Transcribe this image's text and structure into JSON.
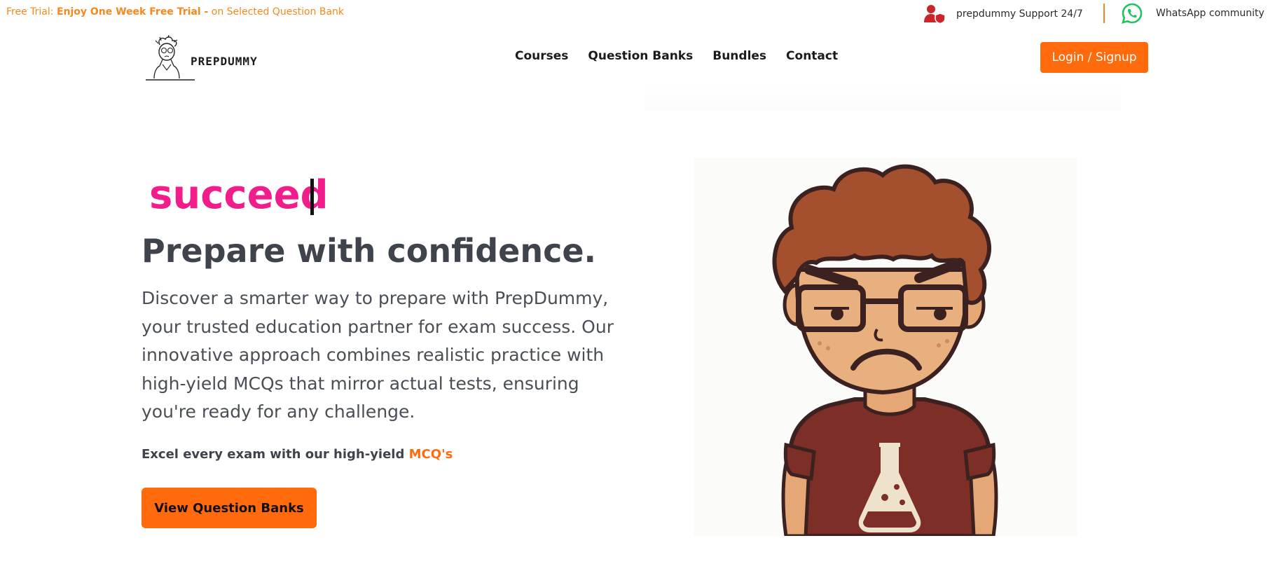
{
  "topbar": {
    "promo_prefix": "Free Trial: ",
    "promo_bold": "Enjoy One Week Free Trial -",
    "promo_suffix": " on Selected Question Bank",
    "support_icon": "user-shield-icon",
    "support_label": "prepdummy Support 24/7",
    "whatsapp_icon": "whatsapp-icon",
    "whatsapp_label": "WhatsApp community"
  },
  "navbar": {
    "logo_text": "PREPDUMMY",
    "links": [
      "Courses",
      "Question Banks",
      "Bundles",
      "Contact"
    ],
    "login_label": "Login / Signup"
  },
  "hero": {
    "typed_word": "succeed",
    "headline": "Prepare with confidence.",
    "description": "Discover a smarter way to prepare with PrepDummy, your trusted education partner for exam success. Our innovative approach combines realistic practice with high-yield MCQs that mirror actual tests, ensuring you're ready for any challenge.",
    "tagline_prefix": "Excel every exam with our high-yield ",
    "tagline_accent": "MCQ's",
    "cta_label": "View Question Banks"
  },
  "colors": {
    "accent": "#ff6a0d",
    "promo": "#f5891f",
    "typed": "#f11d8a",
    "text": "#3f434c"
  }
}
